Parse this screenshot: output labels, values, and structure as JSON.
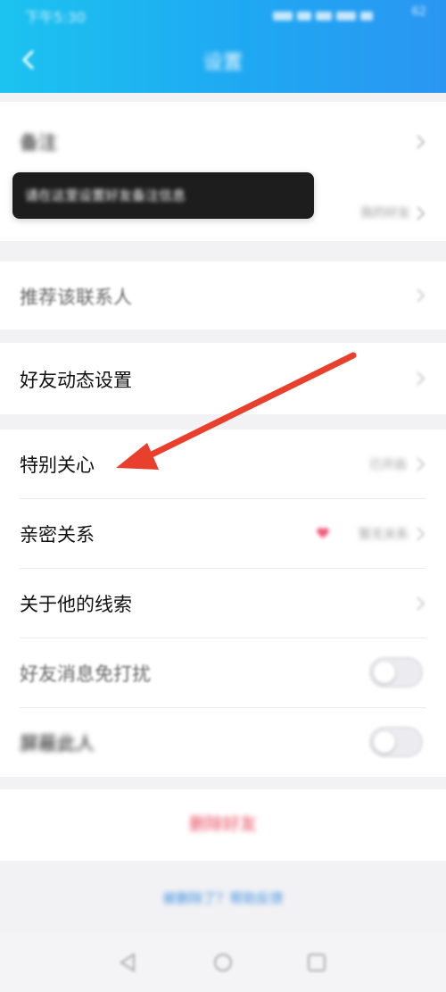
{
  "statusbar": {
    "time": "下午5:30",
    "battery": "62"
  },
  "header": {
    "title": "设置",
    "accent": "#1fa8f2"
  },
  "remark": {
    "label": "备注"
  },
  "tooltip": {
    "text": "请在这里设置好友备注信息"
  },
  "group": {
    "value": "我的好友"
  },
  "recommend": {
    "label": "推荐该联系人"
  },
  "friend_moments": {
    "label": "好友动态设置"
  },
  "special_care": {
    "label": "特别关心",
    "value": "已开启"
  },
  "intimacy": {
    "label": "亲密关系",
    "value": "暂无关系"
  },
  "clues": {
    "label": "关于他的线索"
  },
  "dnd": {
    "label": "好友消息免打扰",
    "enabled": false
  },
  "block": {
    "label": "屏蔽此人",
    "enabled": false
  },
  "delete": {
    "label": "删除好友"
  },
  "footer": {
    "link": "被删除了？帮助反馈"
  },
  "annotation": {
    "arrow_color": "#e8402d"
  }
}
